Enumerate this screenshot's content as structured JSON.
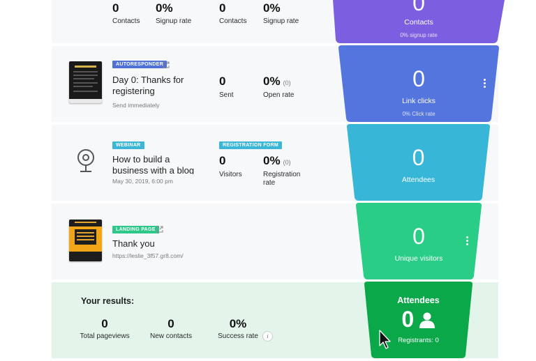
{
  "row1": {
    "stats": [
      {
        "value": "0",
        "label": "Contacts"
      },
      {
        "value": "0%",
        "label": "Signup rate"
      },
      {
        "value": "0",
        "label": "Contacts"
      },
      {
        "value": "0%",
        "label": "Signup rate"
      }
    ],
    "funnel": {
      "value": "0",
      "label": "Contacts",
      "sub": "0% signup rate",
      "color": "#7b5fe0"
    }
  },
  "row2": {
    "badge": "AUTORESPONDER",
    "title_line1": "Day 0: Thanks for",
    "title_line2": "registering",
    "subtitle": "Send immediately",
    "stats": [
      {
        "value": "0",
        "label": "Sent"
      },
      {
        "value": "0%",
        "label": "Open rate"
      }
    ],
    "funnel": {
      "value": "0",
      "label": "Link clicks",
      "sub": "0% Click rate",
      "color": "#5475de"
    }
  },
  "row3": {
    "badge": "WEBINAR",
    "badge2": "REGISTRATION FORM",
    "title_line1": "How to build a",
    "title_line2": "business with a blog",
    "subtitle": "May 30, 2019, 6:00 pm",
    "stats": [
      {
        "value": "0",
        "label": "Visitors"
      },
      {
        "value": "0%",
        "extra": "(0)",
        "label_line1": "Registration",
        "label_line2": "rate"
      }
    ],
    "funnel": {
      "value": "0",
      "label": "Attendees",
      "color": "#38b6d8"
    }
  },
  "row4": {
    "badge": "LANDING PAGE",
    "title": "Thank you",
    "subtitle": "https://leslie_3f57.gr8.com/",
    "funnel": {
      "value": "0",
      "label": "Unique visitors",
      "color": "#29cd86"
    }
  },
  "results": {
    "heading": "Your results:",
    "stats": [
      {
        "value": "0",
        "label": "Total pageviews"
      },
      {
        "value": "0",
        "label": "New contacts"
      },
      {
        "value": "0%",
        "label": "Success rate"
      }
    ],
    "funnel": {
      "title": "Attendees",
      "value": "0",
      "registrants": "Registrants: 0",
      "color": "#0ba84a"
    }
  },
  "row2_open_extra": "(0)",
  "colors": {
    "autoresponder": "#4e72d8",
    "webinar": "#3bb6d6",
    "landing": "#2dc88a",
    "results_bg": "#e3f5ea"
  }
}
